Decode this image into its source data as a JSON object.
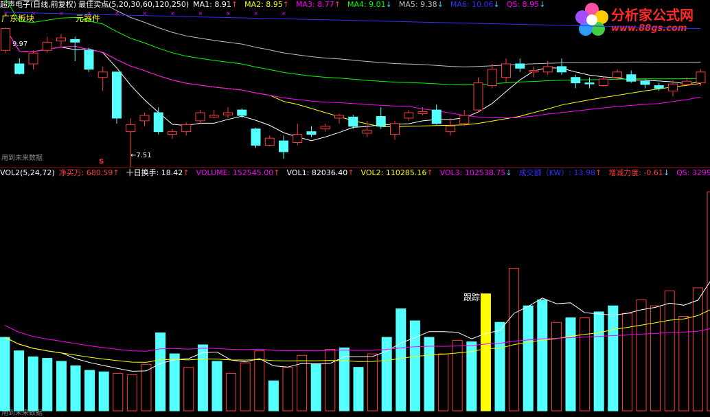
{
  "header": {
    "stock_name": "超声电子",
    "chart_mode": "(日线,前复权)",
    "indicator_name": "最佳买点(5,20,30,60,120,250)",
    "ma_items": [
      {
        "label": "MA1: 8.91",
        "arrow": "↑",
        "color": "#ffffff"
      },
      {
        "label": "MA2: 8.95",
        "arrow": "↑",
        "color": "#ffff00"
      },
      {
        "label": "MA3: 8.77",
        "arrow": "↑",
        "color": "#ff00ff"
      },
      {
        "label": "MA4: 9.01",
        "arrow": "↓",
        "color": "#00ff00"
      },
      {
        "label": "MA5: 9.38",
        "arrow": "↓",
        "color": "#c0c0c0"
      },
      {
        "label": "MA6: 10.06",
        "arrow": "↓",
        "color": "#3030ff"
      },
      {
        "label": "QS: 8.95",
        "arrow": "↓",
        "color": "#ff00ff"
      }
    ],
    "sector_label": "广东板块",
    "industry_label": "元器件",
    "high_price_label": "9.97",
    "low_price_label": "←7.51",
    "s_marker": "S",
    "future_data_label_top": "用到未来数据",
    "future_data_label_bottom": "用到未来数据"
  },
  "volume_header": {
    "indicator_name": "VOL2(5,24,72)",
    "items": [
      {
        "label": "净买万: 680.59",
        "arrow": "↑",
        "color": "#ff3b3b"
      },
      {
        "label": "十日换手: 18.42",
        "arrow": "↑",
        "color": "#ffffff"
      },
      {
        "label": "VOLUME: 152545.00",
        "arrow": "↑",
        "color": "#ff00ff"
      },
      {
        "label": "VOL1: 82036.40",
        "arrow": "↑",
        "color": "#ffffff"
      },
      {
        "label": "VOL2: 110285.16",
        "arrow": "↑",
        "color": "#ffff00"
      },
      {
        "label": "VOL3: 102538.75",
        "arrow": "↓",
        "color": "#ff00ff"
      },
      {
        "label": "成交额（KW）: 13.98",
        "arrow": "↑",
        "color": "#3030ff"
      },
      {
        "label": "增减力度: -0.61",
        "arrow": "↓",
        "color": "#ff3b3b"
      },
      {
        "label": "QS: 3299",
        "arrow": "",
        "color": "#ff00ff"
      }
    ],
    "track_label": "跟踪"
  },
  "logo": {
    "title": "分析家公式网",
    "url": "www.88gs.com"
  },
  "colors": {
    "up_candle": "#ff3b3b",
    "down_candle": "#54ffff",
    "divider": "#7a0000",
    "track_bar": "#ffff00",
    "trend_line": "#ff00ff"
  },
  "chart_data": [
    {
      "type": "candlestick",
      "title": "超声电子",
      "price_range": [
        7.4,
        10.3
      ],
      "high_mark": 9.97,
      "low_mark": 7.51,
      "candles": [
        {
          "o": 9.55,
          "c": 9.95,
          "h": 9.97,
          "l": 9.5
        },
        {
          "o": 9.3,
          "c": 9.12,
          "h": 9.4,
          "l": 9.1
        },
        {
          "o": 9.3,
          "c": 9.5,
          "h": 9.55,
          "l": 9.2
        },
        {
          "o": 9.55,
          "c": 9.7,
          "h": 9.8,
          "l": 9.5
        },
        {
          "o": 9.72,
          "c": 9.78,
          "h": 9.85,
          "l": 9.6
        },
        {
          "o": 9.75,
          "c": 9.7,
          "h": 9.8,
          "l": 9.35
        },
        {
          "o": 9.55,
          "c": 9.2,
          "h": 9.6,
          "l": 9.15
        },
        {
          "o": 9.05,
          "c": 9.15,
          "h": 9.25,
          "l": 8.8
        },
        {
          "o": 9.15,
          "c": 8.3,
          "h": 9.15,
          "l": 8.2
        },
        {
          "o": 8.05,
          "c": 8.18,
          "h": 8.3,
          "l": 7.51
        },
        {
          "o": 8.25,
          "c": 8.35,
          "h": 8.4,
          "l": 8.15
        },
        {
          "o": 8.4,
          "c": 8.05,
          "h": 8.5,
          "l": 8.0
        },
        {
          "o": 8.0,
          "c": 8.05,
          "h": 8.1,
          "l": 7.92
        },
        {
          "o": 8.05,
          "c": 8.18,
          "h": 8.22,
          "l": 7.98
        },
        {
          "o": 8.25,
          "c": 8.4,
          "h": 8.45,
          "l": 8.2
        },
        {
          "o": 8.32,
          "c": 8.35,
          "h": 8.45,
          "l": 8.3
        },
        {
          "o": 8.36,
          "c": 8.4,
          "h": 8.5,
          "l": 8.3
        },
        {
          "o": 8.45,
          "c": 8.35,
          "h": 8.48,
          "l": 8.3
        },
        {
          "o": 8.1,
          "c": 7.8,
          "h": 8.12,
          "l": 7.75
        },
        {
          "o": 7.8,
          "c": 7.93,
          "h": 7.98,
          "l": 7.78
        },
        {
          "o": 7.88,
          "c": 7.68,
          "h": 7.98,
          "l": 7.55
        },
        {
          "o": 7.85,
          "c": 8.0,
          "h": 8.2,
          "l": 7.8
        },
        {
          "o": 8.05,
          "c": 8.0,
          "h": 8.15,
          "l": 7.95
        },
        {
          "o": 8.1,
          "c": 8.15,
          "h": 8.2,
          "l": 8.05
        },
        {
          "o": 8.3,
          "c": 8.35,
          "h": 8.38,
          "l": 8.2
        },
        {
          "o": 8.32,
          "c": 8.15,
          "h": 8.36,
          "l": 8.1
        },
        {
          "o": 8.02,
          "c": 8.08,
          "h": 8.25,
          "l": 7.95
        },
        {
          "o": 8.33,
          "c": 8.15,
          "h": 8.5,
          "l": 8.1
        },
        {
          "o": 8.0,
          "c": 8.2,
          "h": 8.25,
          "l": 7.9
        },
        {
          "o": 8.3,
          "c": 8.4,
          "h": 8.45,
          "l": 8.25
        },
        {
          "o": 8.38,
          "c": 8.42,
          "h": 8.5,
          "l": 8.35
        },
        {
          "o": 8.45,
          "c": 8.2,
          "h": 8.55,
          "l": 8.18
        },
        {
          "o": 8.05,
          "c": 8.15,
          "h": 8.3,
          "l": 7.98
        },
        {
          "o": 8.2,
          "c": 8.35,
          "h": 8.45,
          "l": 8.15
        },
        {
          "o": 8.45,
          "c": 8.95,
          "h": 9.05,
          "l": 8.4
        },
        {
          "o": 8.9,
          "c": 9.2,
          "h": 9.3,
          "l": 8.85
        },
        {
          "o": 9.05,
          "c": 9.3,
          "h": 9.4,
          "l": 8.95
        },
        {
          "o": 9.3,
          "c": 9.22,
          "h": 9.4,
          "l": 9.15
        },
        {
          "o": 9.15,
          "c": 9.18,
          "h": 9.25,
          "l": 9.05
        },
        {
          "o": 9.15,
          "c": 9.25,
          "h": 9.35,
          "l": 9.1
        },
        {
          "o": 9.25,
          "c": 9.15,
          "h": 9.4,
          "l": 9.1
        },
        {
          "o": 9.05,
          "c": 8.95,
          "h": 9.1,
          "l": 8.85
        },
        {
          "o": 8.95,
          "c": 8.93,
          "h": 9.05,
          "l": 8.85
        },
        {
          "o": 8.9,
          "c": 9.02,
          "h": 9.08,
          "l": 8.88
        },
        {
          "o": 9.05,
          "c": 9.15,
          "h": 9.2,
          "l": 9.0
        },
        {
          "o": 9.1,
          "c": 8.98,
          "h": 9.18,
          "l": 8.95
        },
        {
          "o": 8.98,
          "c": 8.92,
          "h": 9.02,
          "l": 8.85
        },
        {
          "o": 8.9,
          "c": 8.85,
          "h": 8.95,
          "l": 8.8
        },
        {
          "o": 8.8,
          "c": 8.93,
          "h": 9.0,
          "l": 8.7
        },
        {
          "o": 8.92,
          "c": 8.98,
          "h": 9.05,
          "l": 8.9
        },
        {
          "o": 8.95,
          "c": 9.15,
          "h": 9.2,
          "l": 8.9
        }
      ]
    },
    {
      "type": "bar",
      "title": "VOL2(5,24,72)",
      "ylim": [
        0,
        152545
      ],
      "values": [
        49000,
        40000,
        36000,
        35000,
        33000,
        30000,
        27000,
        26000,
        25000,
        24000,
        31000,
        52000,
        38000,
        29000,
        44000,
        33000,
        25000,
        32000,
        40000,
        20000,
        29000,
        37000,
        31000,
        41000,
        42000,
        29000,
        38000,
        49000,
        68000,
        60000,
        49000,
        38000,
        47000,
        46000,
        78000,
        59000,
        95000,
        70000,
        74000,
        59000,
        62000,
        62000,
        66000,
        70000,
        65000,
        74000,
        70000,
        80000,
        63000,
        82000,
        146000,
        140000,
        129000,
        93000,
        88000,
        73000,
        77000,
        72000,
        50000,
        48000,
        43000,
        57000,
        36000,
        49000,
        26000,
        61000,
        112000
      ],
      "cyan_index": [
        0,
        1,
        2,
        3,
        4,
        5,
        6,
        7,
        11,
        12,
        14,
        15,
        19,
        22,
        24,
        25,
        27,
        28,
        29,
        30,
        33,
        35,
        37,
        38,
        40,
        42,
        43
      ],
      "track_index": 34
    }
  ]
}
